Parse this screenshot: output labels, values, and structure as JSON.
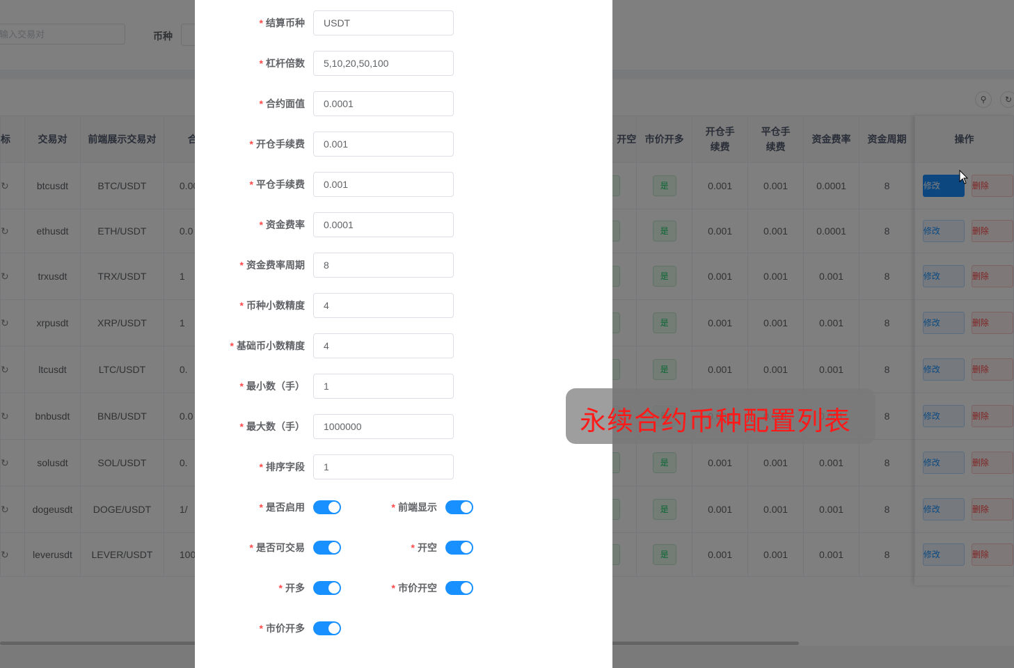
{
  "search": {
    "pair_placeholder": "输入交易对",
    "coin_label": "币种"
  },
  "toolbar": {
    "search_icon": "search-icon",
    "refresh_icon": "refresh-icon"
  },
  "table": {
    "headers": [
      "标",
      "交易对",
      "前端展示交易对",
      "合",
      "开空",
      "市价开多",
      "开仓手续费",
      "平仓手续费",
      "资金费率",
      "资金周期",
      "操作"
    ],
    "rows": [
      {
        "pair": "btcusdt",
        "display": "BTC/USDT",
        "partial": "0.00",
        "yes_market_short": "",
        "yes_market_long": "是",
        "open_fee": "0.001",
        "close_fee": "0.001",
        "funding_rate": "0.0001",
        "funding_period": "8"
      },
      {
        "pair": "ethusdt",
        "display": "ETH/USDT",
        "partial": "0.0",
        "yes_market_long": "是",
        "open_fee": "0.001",
        "close_fee": "0.001",
        "funding_rate": "0.0001",
        "funding_period": "8"
      },
      {
        "pair": "trxusdt",
        "display": "TRX/USDT",
        "partial": "1",
        "yes_market_long": "是",
        "open_fee": "0.001",
        "close_fee": "0.001",
        "funding_rate": "0.001",
        "funding_period": "8"
      },
      {
        "pair": "xrpusdt",
        "display": "XRP/USDT",
        "partial": "1",
        "yes_market_long": "是",
        "open_fee": "0.001",
        "close_fee": "0.001",
        "funding_rate": "0.001",
        "funding_period": "8"
      },
      {
        "pair": "ltcusdt",
        "display": "LTC/USDT",
        "partial": "0.",
        "yes_market_long": "是",
        "open_fee": "0.001",
        "close_fee": "0.001",
        "funding_rate": "0.001",
        "funding_period": "8"
      },
      {
        "pair": "bnbusdt",
        "display": "BNB/USDT",
        "partial": "0.0",
        "yes_market_long": "是",
        "open_fee": "0.001",
        "close_fee": "0.001",
        "funding_rate": "0.001",
        "funding_period": "8"
      },
      {
        "pair": "solusdt",
        "display": "SOL/USDT",
        "partial": "0.",
        "yes_market_long": "是",
        "open_fee": "0.001",
        "close_fee": "0.001",
        "funding_rate": "0.001",
        "funding_period": "8"
      },
      {
        "pair": "dogeusdt",
        "display": "DOGE/USDT",
        "partial": "1/",
        "yes_market_long": "是",
        "open_fee": "0.001",
        "close_fee": "0.001",
        "funding_rate": "0.001",
        "funding_period": "8"
      },
      {
        "pair": "leverusdt",
        "display": "LEVER/USDT",
        "partial": "100",
        "yes_market_long": "是",
        "open_fee": "0.001",
        "close_fee": "0.001",
        "funding_rate": "0.001",
        "funding_period": "8"
      }
    ],
    "edit_label": "修改",
    "delete_label": "删除"
  },
  "form": {
    "settle_coin": {
      "label": "结算币种",
      "value": "USDT"
    },
    "leverage": {
      "label": "杠杆倍数",
      "value": "5,10,20,50,100"
    },
    "face_value": {
      "label": "合约面值",
      "value": "0.0001"
    },
    "open_fee": {
      "label": "开仓手续费",
      "value": "0.001"
    },
    "close_fee": {
      "label": "平仓手续费",
      "value": "0.001"
    },
    "funding_rate": {
      "label": "资金费率",
      "value": "0.0001"
    },
    "funding_period": {
      "label": "资金费率周期",
      "value": "8"
    },
    "coin_precision": {
      "label": "币种小数精度",
      "value": "4"
    },
    "base_precision": {
      "label": "基础币小数精度",
      "value": "4"
    },
    "min_qty": {
      "label": "最小数（手）",
      "value": "1"
    },
    "max_qty": {
      "label": "最大数（手）",
      "value": "1000000"
    },
    "sort": {
      "label": "排序字段",
      "value": "1"
    },
    "enabled": {
      "label": "是否启用",
      "on": true
    },
    "frontend_show": {
      "label": "前端显示",
      "on": true
    },
    "tradable": {
      "label": "是否可交易",
      "on": true
    },
    "short": {
      "label": "开空",
      "on": true
    },
    "long": {
      "label": "开多",
      "on": true
    },
    "market_short": {
      "label": "市价开空",
      "on": true
    },
    "market_long": {
      "label": "市价开多",
      "on": true
    },
    "required_mark": "*"
  },
  "toast": {
    "text": "永续合约币种配置列表"
  },
  "colors": {
    "primary": "#1890ff",
    "danger": "#ff4949",
    "success": "#13ce66"
  }
}
